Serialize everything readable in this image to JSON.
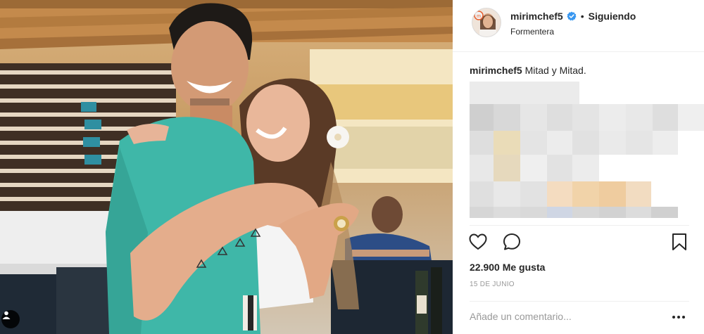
{
  "post": {
    "username": "mirimchef5",
    "separator": "•",
    "follow_status": "Siguiendo",
    "location": "Formentera",
    "caption_user": "mirimchef5",
    "caption_text": "Mitad y Mitad.",
    "likes": "22.900 Me gusta",
    "date": "15 DE JUNIO",
    "comment_placeholder": "Añade un comentario...",
    "more_label": "•••"
  },
  "colors": {
    "verified": "#3897f0",
    "text": "#262626",
    "muted": "#999999",
    "shirt": "#3fb7a8"
  },
  "icons": [
    "verified-badge-icon",
    "heart-icon",
    "comment-icon",
    "bookmark-icon",
    "more-options-icon",
    "user-tag-icon"
  ]
}
